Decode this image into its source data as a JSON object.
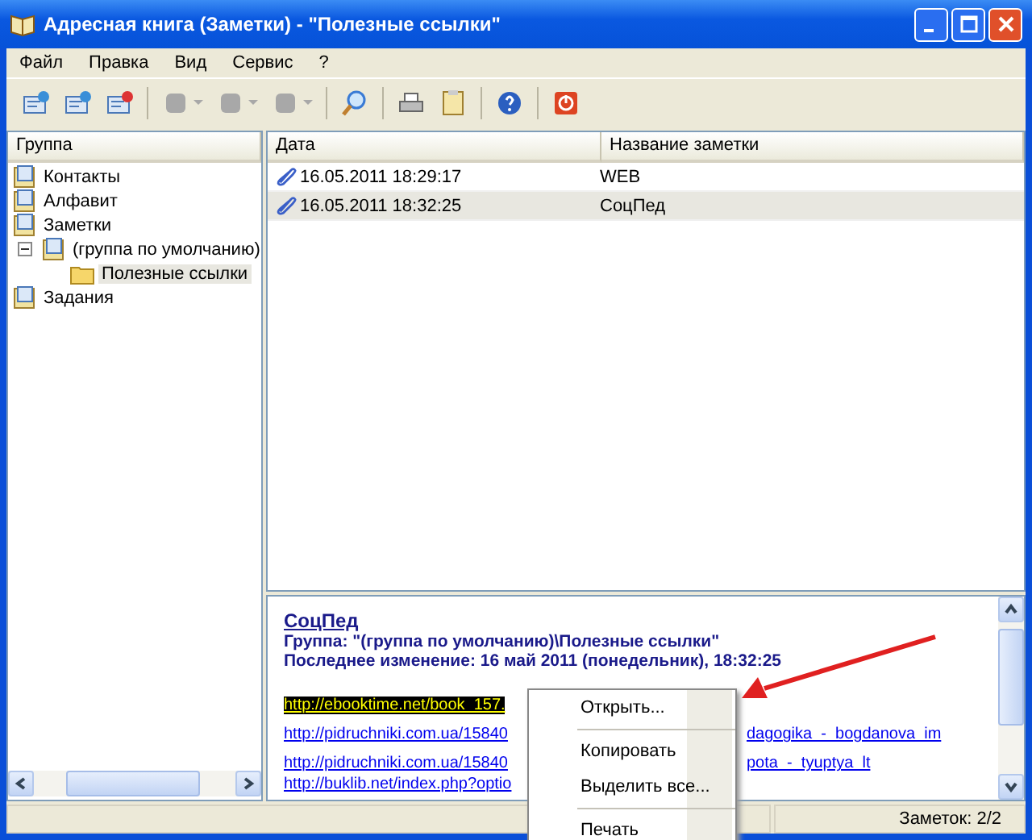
{
  "window": {
    "title": "Адресная книга (Заметки) - \"Полезные ссылки\""
  },
  "menu": [
    {
      "label": "Файл"
    },
    {
      "label": "Правка"
    },
    {
      "label": "Вид"
    },
    {
      "label": "Сервис"
    },
    {
      "label": "?"
    }
  ],
  "toolbar": [
    {
      "kind": "button"
    },
    {
      "kind": "button"
    },
    {
      "kind": "button"
    },
    {
      "kind": "separator"
    },
    {
      "kind": "dropdown",
      "disabled": true
    },
    {
      "kind": "dropdown",
      "disabled": true
    },
    {
      "kind": "dropdown",
      "disabled": true
    },
    {
      "kind": "separator"
    },
    {
      "kind": "button"
    },
    {
      "kind": "separator"
    },
    {
      "kind": "button"
    },
    {
      "kind": "button"
    },
    {
      "kind": "separator"
    },
    {
      "kind": "button"
    },
    {
      "kind": "separator"
    },
    {
      "kind": "button"
    }
  ],
  "sidebar": {
    "header": "Группа",
    "items": [
      {
        "label": "Контакты",
        "selected": false
      },
      {
        "label": "Алфавит",
        "selected": false
      },
      {
        "label": "Заметки",
        "selected": false,
        "children": [
          {
            "label": "(группа по умолчанию)",
            "selected": false,
            "expanded": true,
            "children": [
              {
                "label": "Полезные ссылки",
                "selected": true
              }
            ]
          }
        ]
      },
      {
        "label": "Задания",
        "selected": false
      }
    ]
  },
  "table": {
    "columns": [
      "Дата",
      "Название заметки"
    ],
    "rows": [
      {
        "date": "16.05.2011 18:29:17",
        "name": "WEB",
        "selected": false
      },
      {
        "date": "16.05.2011 18:32:25",
        "name": "СоцПед",
        "selected": true
      }
    ]
  },
  "preview": {
    "title": "СоцПед",
    "group": "Группа: \"(группа по умолчанию)\\Полезные ссылки\"",
    "modified": "Последнее изменение: 16 май 2011 (понедельник), 18:32:25",
    "links": [
      {
        "left": "http://ebooktime.net/book_157.",
        "selected": true
      },
      {
        "left": "http://pidruchniki.com.ua/15840",
        "right": "dagogika_-_bogdanova_im",
        "selected": false
      },
      {
        "left": "http://pidruchniki.com.ua/15840",
        "right": "pota_-_tyuptya_lt",
        "selected": false
      },
      {
        "left": "http://buklib.net/index.php?optio",
        "selected": false
      }
    ]
  },
  "context_menu": [
    {
      "kind": "item",
      "label": "Открыть..."
    },
    {
      "kind": "separator"
    },
    {
      "kind": "item",
      "label": "Копировать"
    },
    {
      "kind": "item",
      "label": "Выделить все..."
    },
    {
      "kind": "separator"
    },
    {
      "kind": "item",
      "label": "Печать"
    }
  ],
  "status_bar": {
    "count": "Заметок: 2/2"
  }
}
